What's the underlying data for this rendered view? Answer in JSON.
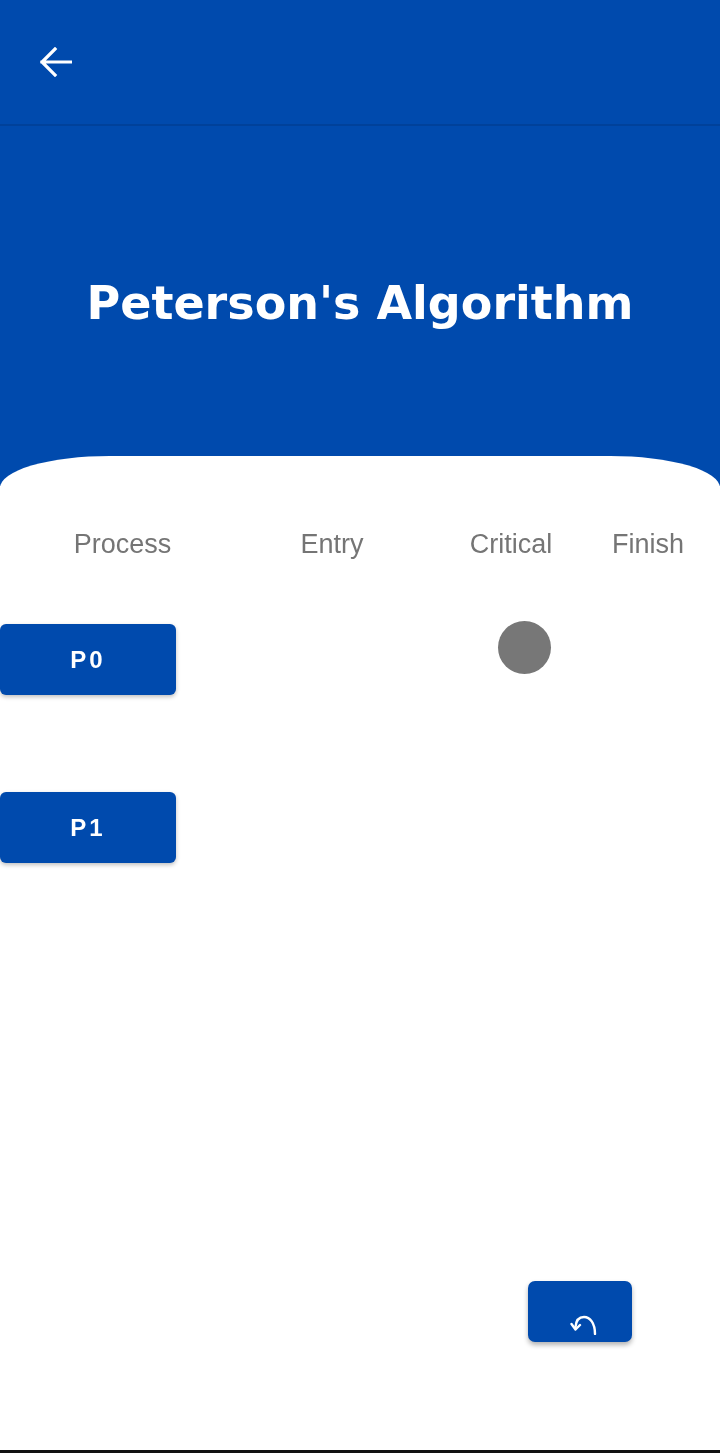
{
  "header": {
    "title": "Peterson's Algorithm"
  },
  "columns": [
    {
      "label": "Process"
    },
    {
      "label": "Entry"
    },
    {
      "label": "Critical"
    },
    {
      "label": "Finish"
    }
  ],
  "processes": [
    {
      "label": "P0",
      "in_entry": false,
      "in_critical": true,
      "in_finish": false
    },
    {
      "label": "P1",
      "in_entry": false,
      "in_critical": false,
      "in_finish": false
    }
  ]
}
